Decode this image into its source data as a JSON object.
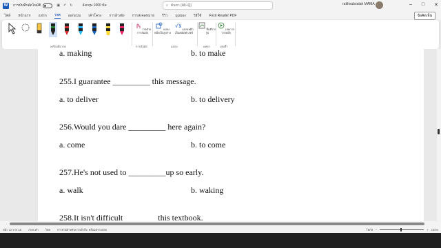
{
  "titlebar": {
    "autosave_label": "การบันทึกอัตโนมัติ",
    "doc_title": "อังกฤษ 1000 ข้อ",
    "search_placeholder": "ค้นหา (Alt+Q)",
    "user_name": "ratthsubsatah MAMA"
  },
  "tabs": [
    "ไฟล์",
    "หน้าแรก",
    "แทรก",
    "วาด",
    "ออกแบบ",
    "เค้าโครง",
    "การอ้างอิง",
    "การส่งจดหมาย",
    "รีวิว",
    "มุมมอง",
    "วิธีใช้",
    "Foxit Reader PDF"
  ],
  "active_tab": "วาด",
  "share_label": "ข้อคิดเห็น",
  "ribbon": {
    "tools_group_label": "เครื่องมือวาด",
    "buttons": [
      {
        "label": "วาดด้วยการสัมผัส",
        "icon": "touch-draw-icon"
      },
      {
        "label": "แปลงหมึกเป็นรูปร่าง",
        "icon": "ink-to-shape-icon"
      },
      {
        "label": "แปลงหมึกเป็นคณิตศาสตร์",
        "icon": "ink-to-math-icon"
      },
      {
        "label": "พื้นที่วาดรูป",
        "icon": "drawing-canvas-icon"
      },
      {
        "label": "เล่นการวาดหมึก",
        "icon": "ink-replay-icon"
      }
    ],
    "group_labels": [
      "การสัมผัส",
      "แปลง",
      "แทรก",
      "เล่นซ้ำ"
    ]
  },
  "document": {
    "prev_options": {
      "a": "a. making",
      "b": "b. to make"
    },
    "questions": [
      {
        "text": "255.I guarantee _________ this message.",
        "a": "a. to deliver",
        "b": "b. to delivery"
      },
      {
        "text": "256.Would you dare _________ here again?",
        "a": "a. come",
        "b": "b. to come"
      },
      {
        "text": "257.He's not used to _________up so early.",
        "a": "a. walk",
        "b": "b. waking"
      },
      {
        "text": "258.It isn't difficult                 this textbook."
      }
    ]
  },
  "status": {
    "page": "หน้า 22 จาก 48",
    "words": "7209 คำ",
    "language": "ไทย",
    "accessibility": "การช่วยสำหรับการเข้าถึง: พร้อมตรวจสอบ",
    "focus": "โฟกัส",
    "zoom": "130%"
  }
}
